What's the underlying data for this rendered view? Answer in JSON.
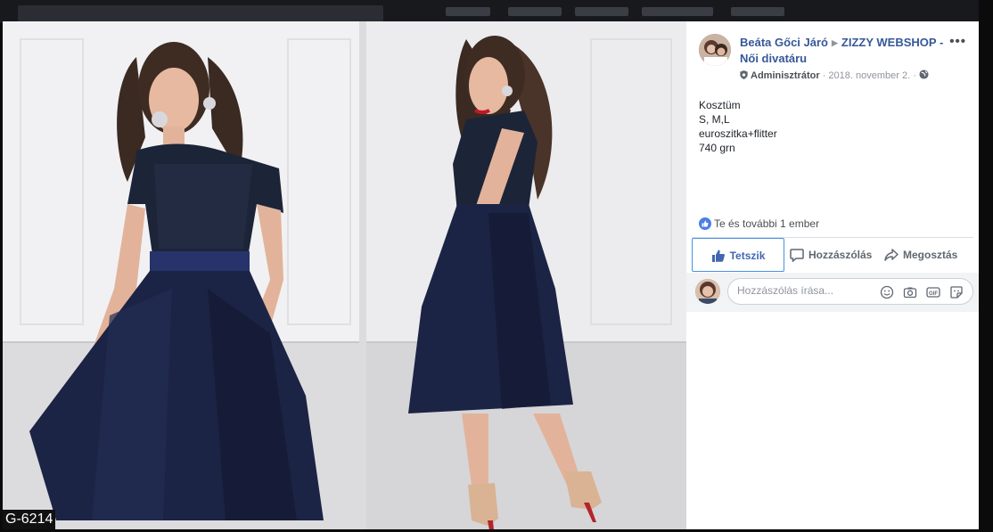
{
  "post": {
    "author": "Beáta Gőci Járó",
    "group": "ZIZZY WEBSHOP - Női divatáru",
    "role": "Adminisztrátor",
    "date": "2018. november 2.",
    "more": "•••",
    "body_lines": [
      "Kosztüm",
      "S, M,L",
      "euroszitka+flitter",
      "740 grn"
    ]
  },
  "photo": {
    "code_label": "G-6214"
  },
  "reactions": {
    "summary": "Te és további 1 ember"
  },
  "actions": {
    "like": "Tetszik",
    "comment": "Hozzászólás",
    "share": "Megosztás"
  },
  "comment_box": {
    "placeholder": "Hozzászólás írása..."
  },
  "icons": {
    "emoji": "emoji-icon",
    "camera": "camera-icon",
    "gif": "gif-icon",
    "sticker": "sticker-icon"
  },
  "colors": {
    "link": "#365899",
    "like_active": "#4267b2",
    "dress_navy": "#1b2444"
  }
}
